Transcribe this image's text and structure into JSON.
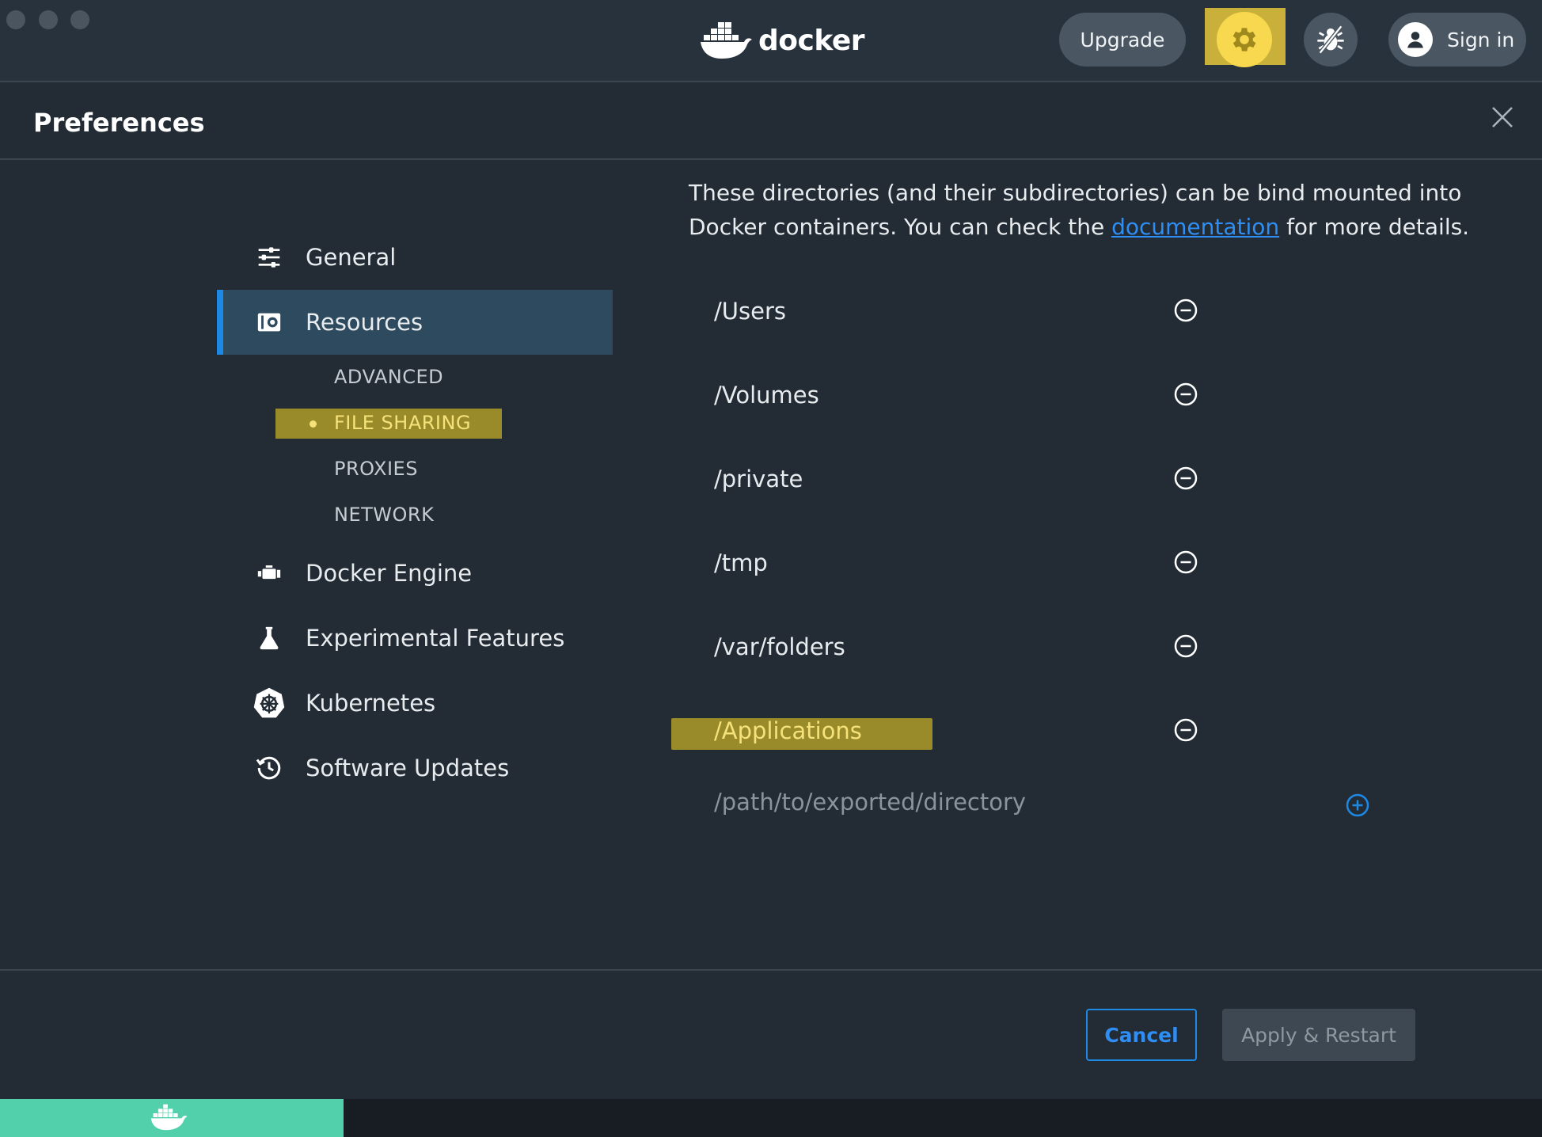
{
  "titlebar": {
    "logo_text": "docker",
    "upgrade_label": "Upgrade",
    "signin_label": "Sign in"
  },
  "header": {
    "title": "Preferences"
  },
  "sidebar": {
    "items": [
      {
        "label": "General",
        "icon": "sliders-icon"
      },
      {
        "label": "Resources",
        "icon": "resources-icon",
        "active": true
      },
      {
        "label": "Docker Engine",
        "icon": "engine-icon"
      },
      {
        "label": "Experimental Features",
        "icon": "flask-icon"
      },
      {
        "label": "Kubernetes",
        "icon": "kubernetes-icon"
      },
      {
        "label": "Software Updates",
        "icon": "history-icon"
      }
    ],
    "subitems": [
      {
        "label": "ADVANCED"
      },
      {
        "label": "FILE SHARING",
        "active": true
      },
      {
        "label": "PROXIES"
      },
      {
        "label": "NETWORK"
      }
    ]
  },
  "content": {
    "description_before": "These directories (and their subdirectories) can be bind mounted into Docker containers. You can check the ",
    "description_link": "documentation",
    "description_after": " for more details.",
    "directories": [
      "/Users",
      "/Volumes",
      "/private",
      "/tmp",
      "/var/folders",
      "/Applications"
    ],
    "new_path_placeholder": "/path/to/exported/directory"
  },
  "footer": {
    "cancel_label": "Cancel",
    "apply_label": "Apply & Restart"
  },
  "colors": {
    "accent": "#1e88e5",
    "highlight": "#9a8b2a",
    "gear_active": "#f7d84e",
    "status_green": "#52d0ac"
  }
}
